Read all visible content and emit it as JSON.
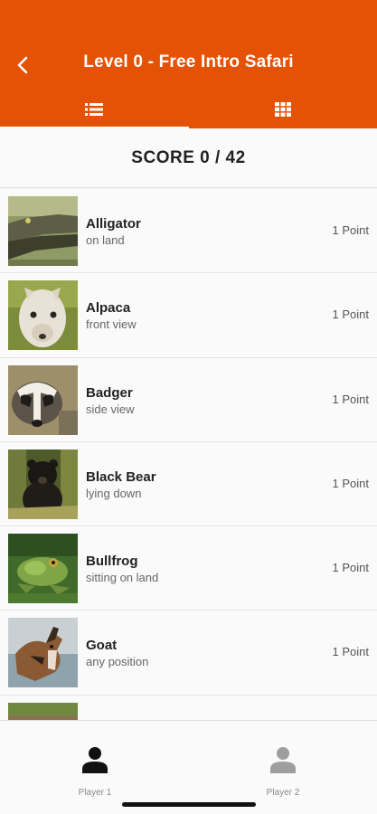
{
  "header": {
    "title": "Level 0 - Free Intro Safari",
    "back_icon": "chevron-left-icon",
    "tabs": [
      {
        "icon": "list-icon",
        "selected": true
      },
      {
        "icon": "grid-icon",
        "selected": false
      }
    ],
    "accent_color": "#e35205"
  },
  "score": {
    "text": "SCORE 0 / 42"
  },
  "animals": [
    {
      "name": "Alligator",
      "description": "on land",
      "points": "1 Point"
    },
    {
      "name": "Alpaca",
      "description": "front view",
      "points": "1 Point"
    },
    {
      "name": "Badger",
      "description": "side view",
      "points": "1 Point"
    },
    {
      "name": "Black Bear",
      "description": "lying down",
      "points": "1 Point"
    },
    {
      "name": "Bullfrog",
      "description": "sitting on land",
      "points": "1 Point"
    },
    {
      "name": "Goat",
      "description": "any position",
      "points": "1 Point"
    }
  ],
  "bottom_nav": {
    "player1": {
      "label": "Player 1",
      "icon": "person-icon",
      "active": true
    },
    "player2": {
      "label": "Player 2",
      "icon": "person-icon",
      "active": false
    }
  }
}
